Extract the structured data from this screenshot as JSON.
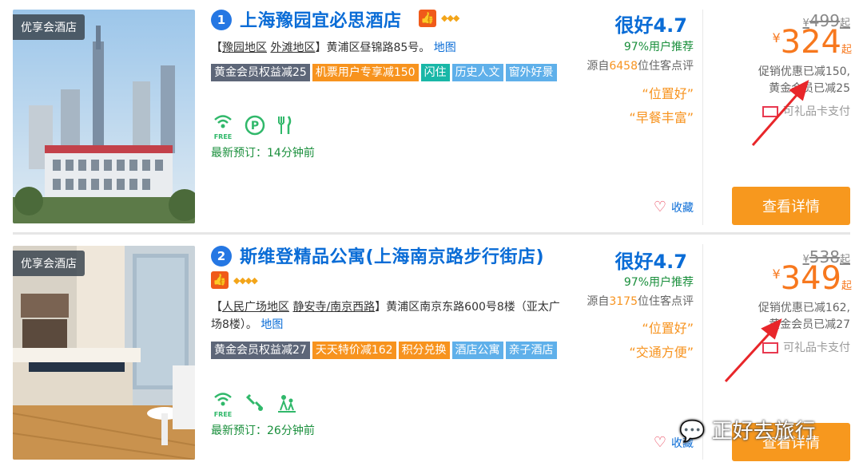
{
  "hotels": [
    {
      "ribbon": "优享会酒店",
      "rank": "1",
      "name": "上海豫园宜必思酒店",
      "diamonds": "◆◆◆",
      "address": {
        "open": "【",
        "area1": "豫园地区",
        "area2": "外滩地区",
        "close": "】黄浦区昼锦路85号。",
        "map": "地图"
      },
      "tags": [
        {
          "label": "黄金会员权益减25",
          "style": "dark"
        },
        {
          "label": "机票用户专享减150",
          "style": "orange"
        },
        {
          "label": "闪住",
          "style": "teal"
        },
        {
          "label": "历史人文",
          "style": "sky"
        },
        {
          "label": "窗外好景",
          "style": "sky"
        }
      ],
      "facilities": [
        "wifi-icon",
        "parking-icon",
        "restaurant-icon"
      ],
      "free_label": "FREE",
      "recent_booking": "最新预订：14分钟前",
      "score": "很好4.7",
      "recommend": "97%用户推荐",
      "reviews_prefix": "源自",
      "reviews_count": "6458",
      "reviews_suffix": "位住客点评",
      "quotes": [
        "“位置好”",
        "“早餐丰富”"
      ],
      "favorite": "收藏",
      "old_price": "499",
      "price": "324",
      "currency": "¥",
      "qi": "起",
      "promo_line1": "促销优惠已减150,",
      "promo_line2": "黄金会员已减25",
      "gift": "可礼品卡支付",
      "detail_button": "查看详情"
    },
    {
      "ribbon": "优享会酒店",
      "rank": "2",
      "name": "斯维登精品公寓(上海南京路步行街店)",
      "diamonds": "◆◆◆◆",
      "address": {
        "open": "【",
        "area1": "人民广场地区",
        "area2": "静安寺/南京西路",
        "close": "】黄浦区南京东路600号8楼（亚太广场8楼）。",
        "map": "地图"
      },
      "tags": [
        {
          "label": "黄金会员权益减27",
          "style": "dark"
        },
        {
          "label": "天天特价减162",
          "style": "orange"
        },
        {
          "label": "积分兑换",
          "style": "orange"
        },
        {
          "label": "酒店公寓",
          "style": "sky"
        },
        {
          "label": "亲子酒店",
          "style": "sky"
        }
      ],
      "facilities": [
        "wifi-icon",
        "tools-icon",
        "family-icon"
      ],
      "free_label": "FREE",
      "recent_booking": "最新预订：26分钟前",
      "score": "很好4.7",
      "recommend": "97%用户推荐",
      "reviews_prefix": "源自",
      "reviews_count": "3175",
      "reviews_suffix": "位住客点评",
      "quotes": [
        "“位置好”",
        "“交通方便”"
      ],
      "favorite": "收藏",
      "old_price": "538",
      "price": "349",
      "currency": "¥",
      "qi": "起",
      "promo_line1": "促销优惠已减162,",
      "promo_line2": "黄金会员已减27",
      "gift": "可礼品卡支付",
      "detail_button": "查看详情"
    }
  ],
  "watermark": "正好去旅行",
  "colors": {
    "brand_blue": "#0a6cd6",
    "orange": "#f7981e",
    "annotation_red": "#e8262a"
  }
}
